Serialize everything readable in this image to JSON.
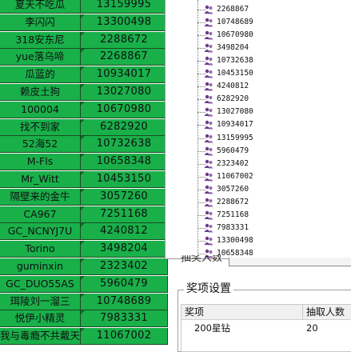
{
  "sheet": {
    "rows": [
      {
        "name": "夏天不吃瓜",
        "number": "13159995"
      },
      {
        "name": "李闪闪",
        "number": "13300498"
      },
      {
        "name": "318安东尼",
        "number": "2288672"
      },
      {
        "name": "yue落乌啼",
        "number": "2268867"
      },
      {
        "name": "瓜蓝的",
        "number": "10934017"
      },
      {
        "name": "赖皮土狗",
        "number": "13027080"
      },
      {
        "name": "100004",
        "number": "10670980"
      },
      {
        "name": "找不到家",
        "number": "6282920"
      },
      {
        "name": "52海52",
        "number": "10732638"
      },
      {
        "name": "M-Fls",
        "number": "10658348"
      },
      {
        "name": "Mr_Witt",
        "number": "10453150"
      },
      {
        "name": "隔壁来的金牛",
        "number": "3057260"
      },
      {
        "name": "CA967",
        "number": "7251168"
      },
      {
        "name": "GC_NCNYJ7U",
        "number": "4240812"
      },
      {
        "name": "Torino",
        "number": "3498204"
      },
      {
        "name": "guminxin",
        "number": "2323402"
      },
      {
        "name": "GC_DUO55AS",
        "number": "5960479"
      },
      {
        "name": "珥陵刘一溜三",
        "number": "10748689"
      },
      {
        "name": "悦伊小精灵",
        "number": "7983331"
      },
      {
        "name": "我与毒瘾不共戴天",
        "number": "11067002"
      }
    ],
    "cell_color": "#19b04a"
  },
  "tree": {
    "items": [
      "2268867",
      "10748689",
      "10670980",
      "3498204",
      "10732638",
      "10453150",
      "4240812",
      "6282920",
      "13027080",
      "10934017",
      "13159995",
      "5960479",
      "2323402",
      "11067002",
      "3057260",
      "2288672",
      "7251168",
      "7983331",
      "13300498",
      "10658348"
    ],
    "icon": "person-group-icon",
    "icon_color": "#6b3a8c"
  },
  "hidden_field": {
    "label": "抽奖人数"
  },
  "prize": {
    "legend": "奖项设置",
    "columns": [
      "奖项",
      "抽取人数"
    ],
    "rows": [
      {
        "prize": "200星钻",
        "count": "20"
      }
    ]
  }
}
